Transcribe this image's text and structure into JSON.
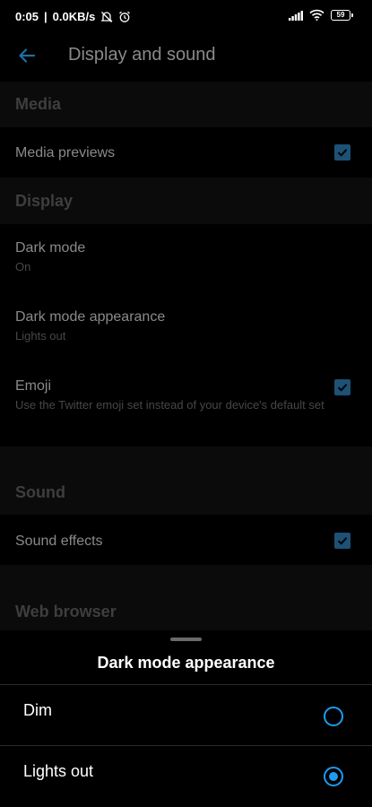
{
  "status_bar": {
    "time": "0:05",
    "separator": "|",
    "network_speed": "0.0KB/s",
    "icons": [
      "alarm-off-icon",
      "alarm-clock-icon",
      "signal-icon",
      "wifi-icon"
    ],
    "battery_level": "59"
  },
  "app_bar": {
    "back_icon": "arrow-left-icon",
    "title": "Display and sound"
  },
  "sections": {
    "media": {
      "header": "Media",
      "media_previews": {
        "title": "Media previews",
        "checked": true
      }
    },
    "display": {
      "header": "Display",
      "dark_mode": {
        "title": "Dark mode",
        "subtitle": "On"
      },
      "dark_mode_appearance": {
        "title": "Dark mode appearance",
        "subtitle": "Lights out"
      },
      "emoji": {
        "title": "Emoji",
        "subtitle": "Use the Twitter emoji set instead of your device's default set",
        "checked": true
      }
    },
    "sound": {
      "header": "Sound",
      "sound_effects": {
        "title": "Sound effects",
        "checked": true
      }
    },
    "web_browser": {
      "header": "Web browser"
    }
  },
  "sheet": {
    "title": "Dark mode appearance",
    "options": [
      {
        "label": "Dim",
        "selected": false
      },
      {
        "label": "Lights out",
        "selected": true
      }
    ]
  },
  "colors": {
    "accent": "#1d9bf0",
    "checkbox_dimmed": "#1d5175",
    "background": "#000000",
    "section_background": "#0b0b0b"
  }
}
